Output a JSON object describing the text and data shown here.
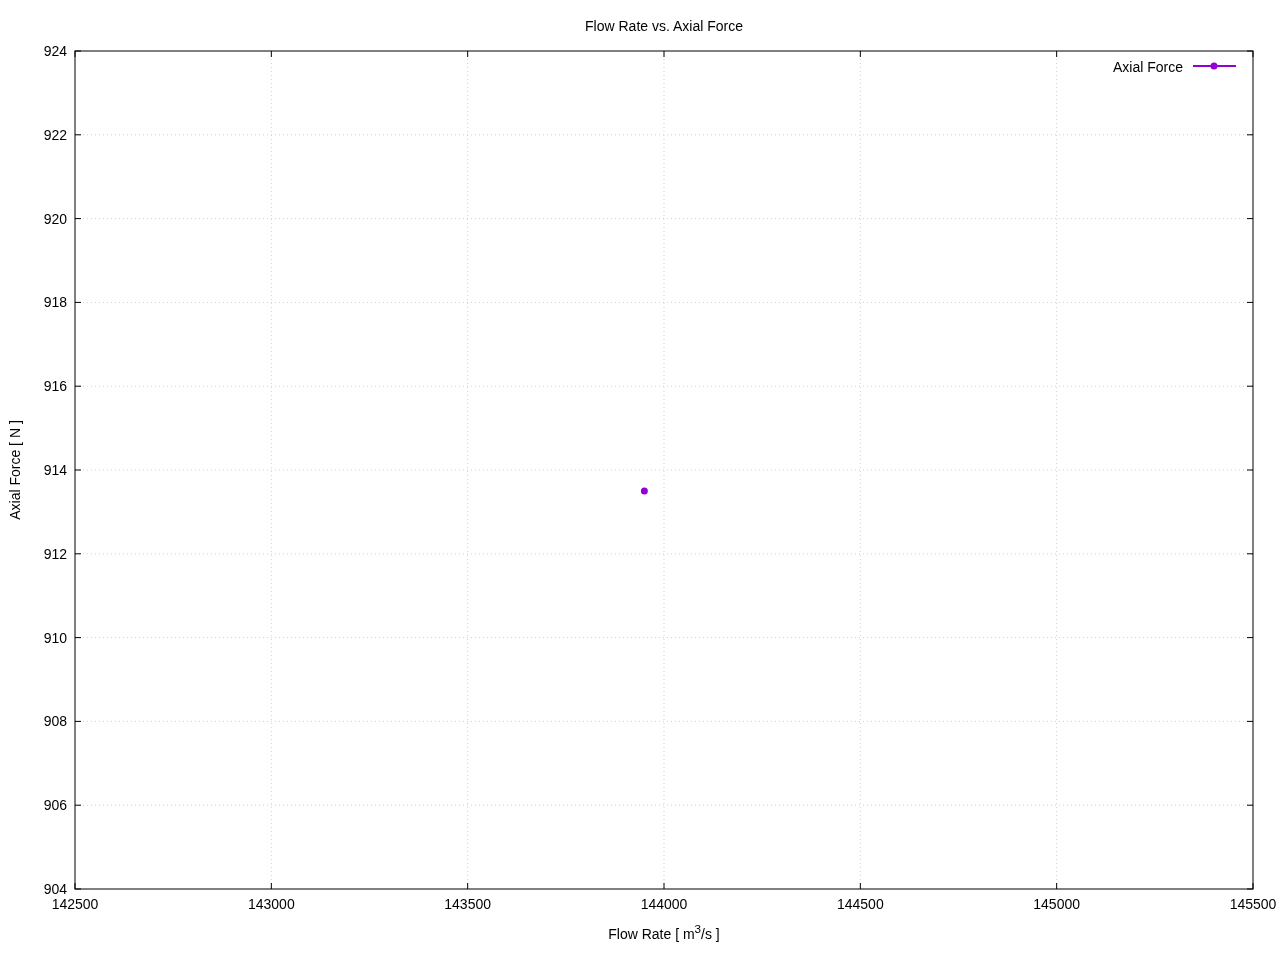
{
  "plot": {
    "chart_data": {
      "type": "scatter",
      "title": "Flow Rate vs. Axial Force",
      "xlabel": "Flow Rate [ m$^{3}$/s ]",
      "ylabel": "Axial Force [ N ]",
      "xlim": [
        142500,
        145500
      ],
      "ylim": [
        904,
        924
      ],
      "xticks": [
        142500,
        143000,
        143500,
        144000,
        144500,
        145000,
        145500
      ],
      "grid": true,
      "yticks": [
        904,
        906,
        908,
        910,
        912,
        914,
        916,
        918,
        920,
        922,
        924
      ],
      "x": [
        143950
      ],
      "series": [
        {
          "name": "Axial Force",
          "color": "#9400d3",
          "values": [
            913.5
          ]
        }
      ]
    }
  }
}
